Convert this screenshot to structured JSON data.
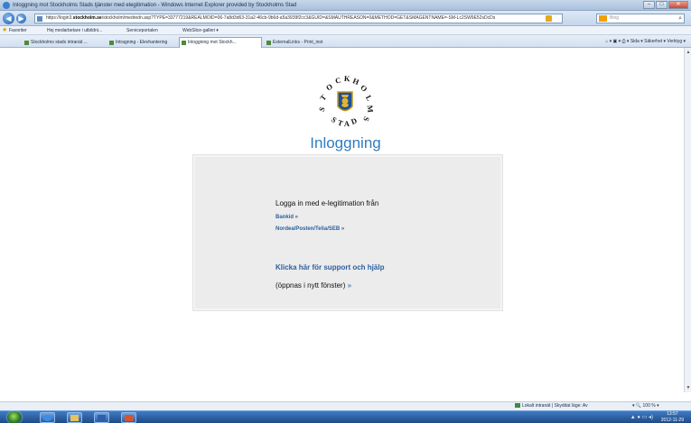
{
  "browser": {
    "title": "Inloggning mot Stockholms Stads tjänster med elegitimation - Windows Internet Explorer provided by Stockholms Stad",
    "url_prefix": "https://login3.",
    "url_domain": "stockholm.se",
    "url_rest": "/stockholm/medredn.asp?TYPE=33777219&REALMOID=06-7a8d3d63-31a2-46cb-9b6d-a5a3939f2cc3&GUID=&SMAUTHREASON=0&METHOD=GET&SMAGENTNAME=-SM-Lc2SW9E52sDcDs",
    "search_placeholder": "Bing",
    "favorites": [
      "Favoriter",
      "Hej medarbetare i utbildni...",
      "Serviceportalen",
      "WebSlice-galleri ▾"
    ],
    "tabs": [
      "Stockholms stads intranät ...",
      "Intragning - Elevhantering",
      "Inloggning mot Stockh...",
      "ExternalLinks - Print_inst"
    ],
    "tools": "Sida ▾  Säkerhet ▾  Verktyg ▾",
    "status_zone": "Lokalt intranät | Skyddat läge: Av",
    "zoom": "100 %",
    "clock_time": "13:57",
    "clock_date": "2012-11-29"
  },
  "page": {
    "logo_text": "STOCKHOLMS STAD",
    "heading": "Inloggning",
    "intro": "Logga in med e-legitimation från",
    "link_bankid": "Bankid »",
    "link_nordea": "Nordea/Posten/Telia/SEB »",
    "support": "Klicka här för support och hjälp",
    "note": "(öppnas i nytt fönster)",
    "note_arrow": "»"
  },
  "colors": {
    "heading": "#2f7cc1",
    "links": "#2a5f9e",
    "panel": "#ececec"
  }
}
